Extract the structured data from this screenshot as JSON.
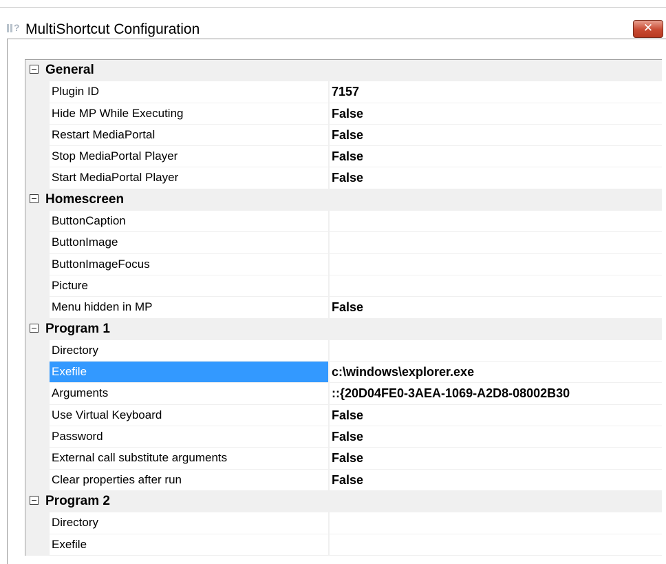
{
  "window": {
    "title": "MultiShortcut Configuration",
    "close_glyph": "✕"
  },
  "categories": [
    {
      "label": "General",
      "properties": [
        {
          "name": "Plugin ID",
          "value": "7157"
        },
        {
          "name": "Hide MP While Executing",
          "value": "False"
        },
        {
          "name": "Restart MediaPortal",
          "value": "False"
        },
        {
          "name": "Stop MediaPortal Player",
          "value": "False"
        },
        {
          "name": "Start MediaPortal Player",
          "value": "False"
        }
      ]
    },
    {
      "label": "Homescreen",
      "properties": [
        {
          "name": "ButtonCaption",
          "value": ""
        },
        {
          "name": "ButtonImage",
          "value": ""
        },
        {
          "name": "ButtonImageFocus",
          "value": ""
        },
        {
          "name": "Picture",
          "value": ""
        },
        {
          "name": "Menu hidden in MP",
          "value": "False"
        }
      ]
    },
    {
      "label": "Program 1",
      "properties": [
        {
          "name": "Directory",
          "value": ""
        },
        {
          "name": "Exefile",
          "value": "c:\\windows\\explorer.exe",
          "selected": true
        },
        {
          "name": "Arguments",
          "value": "::{20D04FE0-3AEA-1069-A2D8-08002B30"
        },
        {
          "name": "Use Virtual Keyboard",
          "value": "False"
        },
        {
          "name": "Password",
          "value": "False"
        },
        {
          "name": "External call substitute arguments",
          "value": "False"
        },
        {
          "name": "Clear properties after run",
          "value": "False"
        }
      ]
    },
    {
      "label": "Program 2",
      "properties": [
        {
          "name": "Directory",
          "value": ""
        },
        {
          "name": "Exefile",
          "value": ""
        }
      ]
    }
  ],
  "colors": {
    "selection": "#3399ff",
    "grid_line": "#f0f0f0",
    "close_button": "#c84a32"
  }
}
